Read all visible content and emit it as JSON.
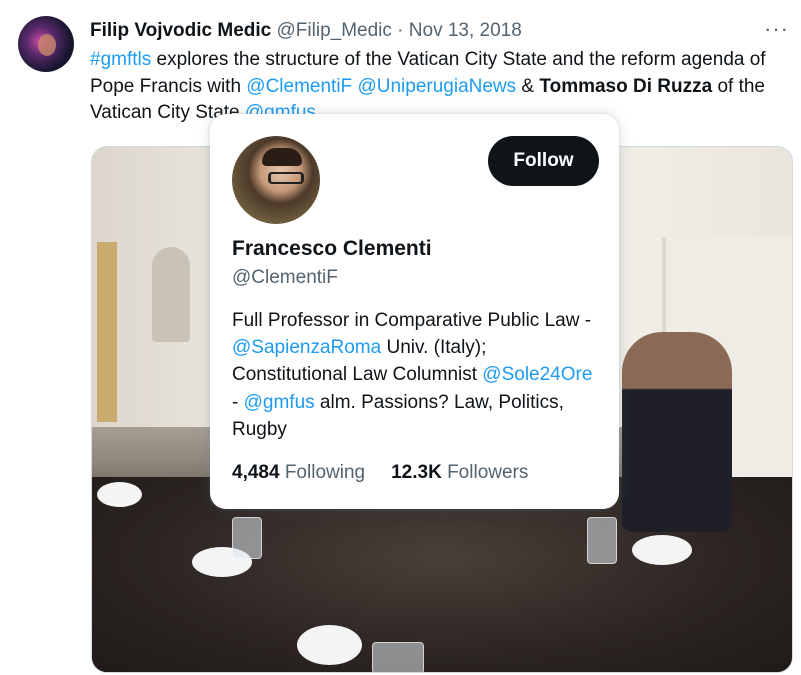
{
  "tweet": {
    "author_name": "Filip Vojvodic Medic",
    "author_handle": "@Filip_Medic",
    "separator": "·",
    "date": "Nov 13, 2018",
    "more_label": "···",
    "text": {
      "hashtag": "#gmftls",
      "part1": " explores the structure of the Vatican City State and the reform agenda of Pope Francis with ",
      "mention1": "@ClementiF",
      "space": " ",
      "mention2": "@UniperugiaNews",
      "amp": " & ",
      "bold_name": "Tommaso Di Ruzza",
      "part2": " of the Vatican City State ",
      "mention3": "@gmfus"
    }
  },
  "hover_card": {
    "follow_label": "Follow",
    "name": "Francesco Clementi",
    "handle": "@ClementiF",
    "bio": {
      "t1": "Full Professor in Comparative Public Law - ",
      "m1": "@SapienzaRoma",
      "t2": " Univ. (Italy); Constitutional Law Columnist ",
      "m2": "@Sole24Ore",
      "t3": " - ",
      "m3": "@gmfus",
      "t4": " alm. Passions? Law, Politics, Rugby"
    },
    "following_count": "4,484",
    "following_label": "Following",
    "followers_count": "12.3K",
    "followers_label": "Followers"
  },
  "colors": {
    "link": "#1d9bf0",
    "text_primary": "#0f1419",
    "text_secondary": "#536471",
    "follow_button_bg": "#0f1419"
  }
}
